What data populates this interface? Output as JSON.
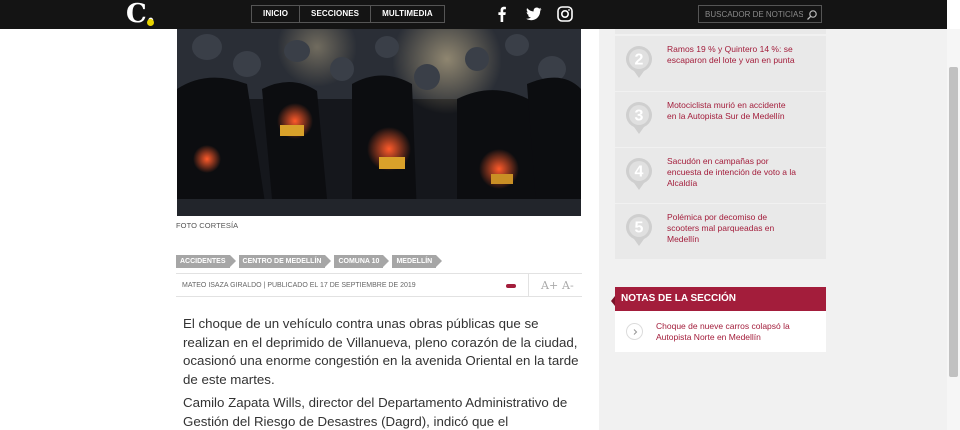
{
  "header": {
    "logo_letter": "C.",
    "nav": [
      "INICIO",
      "SECCIONES",
      "MULTIMEDIA"
    ],
    "social": [
      "facebook-icon",
      "twitter-icon",
      "instagram-icon"
    ],
    "search_placeholder": "BUSCADOR DE NOTICIAS"
  },
  "article": {
    "photo_caption": "FOTO CORTESÍA",
    "tags": [
      "ACCIDENTES",
      "CENTRO DE MEDELLÍN",
      "COMUNA 10",
      "MEDELLÍN"
    ],
    "byline": "MATEO ISAZA GIRALDO | PUBLICADO EL 17 DE SEPTIEMBRE DE 2019",
    "font_larger": "A+",
    "font_smaller": "A-",
    "paragraph_1": "El choque de un vehículo contra unas obras públicas que se realizan en el deprimido de Villanueva, pleno corazón de la ciudad, ocasionó una enorme congestión en la avenida Oriental en la tarde de este martes.",
    "paragraph_2": "Camilo Zapata Wills, director del Departamento Administrativo de Gestión del Riesgo de Desastres (Dagrd), indicó que el"
  },
  "most_read": [
    {
      "number": "2",
      "title": "Ramos 19 % y Quintero 14 %: se escaparon del lote y van en punta"
    },
    {
      "number": "3",
      "title": "Motociclista murió en accidente en la Autopista Sur de Medellín"
    },
    {
      "number": "4",
      "title": "Sacudón en campañas por encuesta de intención de voto a la Alcaldía"
    },
    {
      "number": "5",
      "title": "Polémica por decomiso de scooters mal parqueadas en Medellín"
    }
  ],
  "section_notes": {
    "heading": "NOTAS DE LA SECCIÓN",
    "items": [
      {
        "title": "Choque de nueve carros colapsó la Autopista Norte en Medellín"
      }
    ]
  },
  "colors": {
    "accent": "#a31d3b",
    "topbar": "#141414",
    "logo_dot": "#e8d400",
    "tag_bg": "#a6a6a6"
  }
}
